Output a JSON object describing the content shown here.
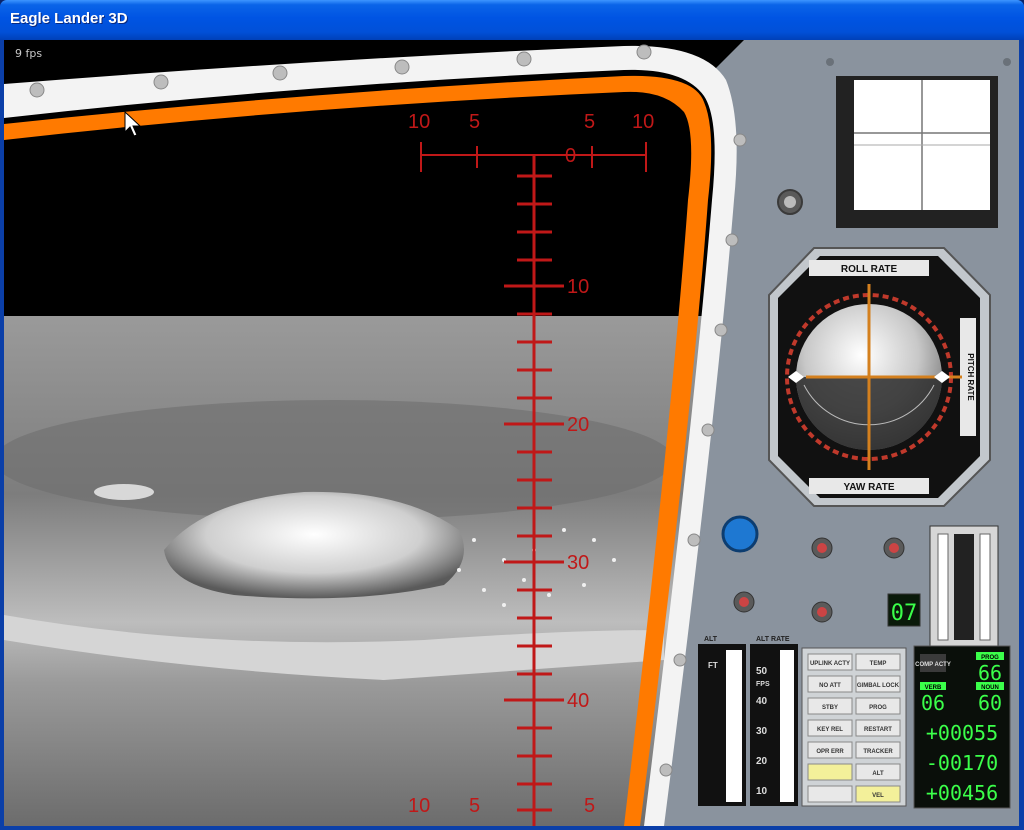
{
  "window": {
    "title": "Eagle Lander 3D"
  },
  "overlay": {
    "fps": "9 fps"
  },
  "reticle": {
    "top_labels": [
      "10",
      "5",
      "0",
      "5",
      "10"
    ],
    "scale_labels": [
      "10",
      "20",
      "30",
      "40"
    ],
    "bottom_labels": [
      "10",
      "5",
      "5"
    ]
  },
  "attitude": {
    "roll_rate": "ROLL RATE",
    "yaw_rate": "YAW RATE",
    "pitch_rate": "PITCH RATE"
  },
  "gauges": {
    "alt_label": "ALT",
    "alt_rate_label": "ALT RATE",
    "fps_ticks": [
      "50",
      "40",
      "30",
      "20",
      "10"
    ],
    "fps": "FPS",
    "ft": "FT"
  },
  "fuel": {
    "readout": "07"
  },
  "keypad": {
    "buttons": [
      "UPLINK ACTY",
      "TEMP",
      "NO ATT",
      "GIMBAL LOCK",
      "STBY",
      "PROG",
      "KEY REL",
      "RESTART",
      "OPR ERR",
      "TRACKER",
      "",
      "ALT",
      "",
      "VEL"
    ]
  },
  "dsky": {
    "comp_acty": "COMP ACTY",
    "prog_label": "PROG",
    "prog": "66",
    "verb_label": "VERB",
    "verb": "06",
    "noun_label": "NOUN",
    "noun": "60",
    "r1": "+00055",
    "r2": "-00170",
    "r3": "+00456"
  },
  "colors": {
    "accent": "#c01818",
    "frame": "#ff7a00",
    "panel": "#8a939e",
    "dsky_green": "#3bff4a"
  }
}
